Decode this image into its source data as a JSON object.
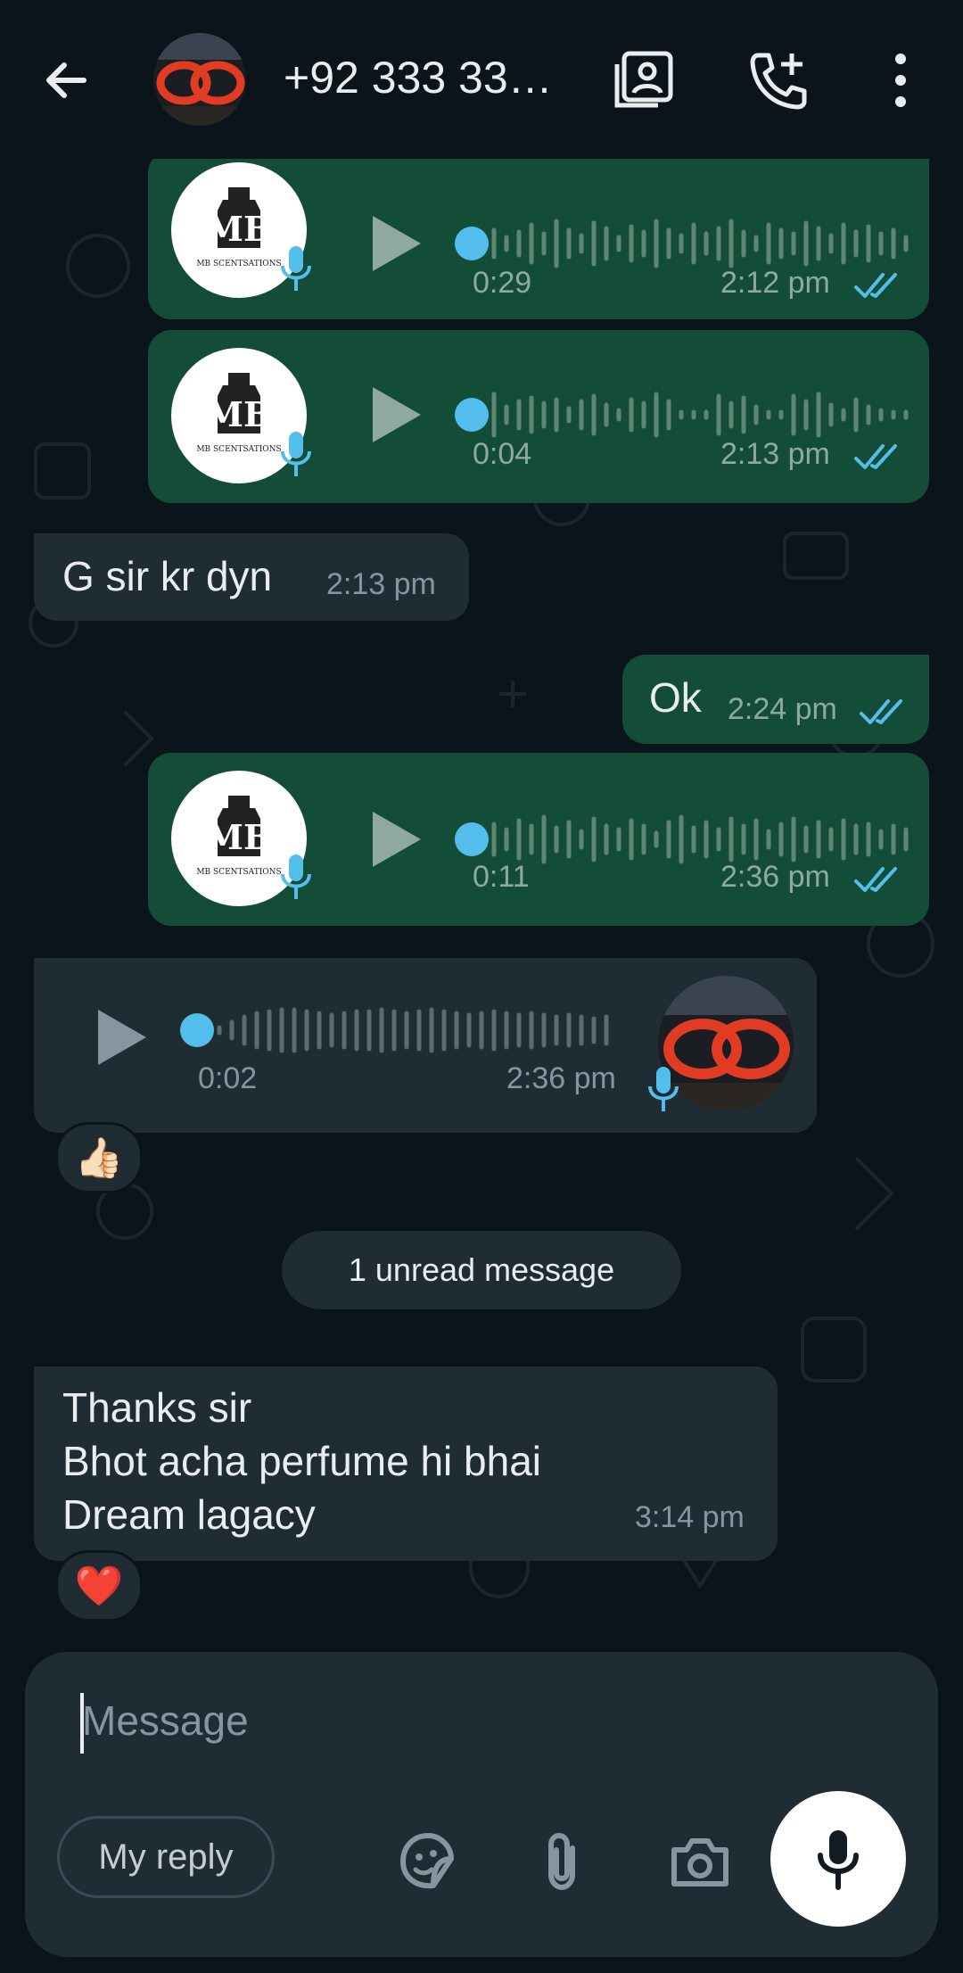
{
  "header": {
    "title": "+92 333 33…",
    "icons": [
      "back-arrow-icon",
      "contact-card-icon",
      "add-call-icon",
      "more-vert-icon"
    ]
  },
  "voice_logo_text": "MB SCENTSATIONS",
  "messages": [
    {
      "type": "voice",
      "direction": "out",
      "duration": "0:29",
      "time": "2:12 pm",
      "status": "read"
    },
    {
      "type": "voice",
      "direction": "out",
      "duration": "0:04",
      "time": "2:13 pm",
      "status": "read"
    },
    {
      "type": "text",
      "direction": "in",
      "text": "G sir kr dyn",
      "time": "2:13 pm"
    },
    {
      "type": "text",
      "direction": "out",
      "text": "Ok",
      "time": "2:24 pm",
      "status": "read"
    },
    {
      "type": "voice",
      "direction": "out",
      "duration": "0:11",
      "time": "2:36 pm",
      "status": "read"
    },
    {
      "type": "voice",
      "direction": "in",
      "duration": "0:02",
      "time": "2:36 pm",
      "reaction": "👍🏻"
    }
  ],
  "unread_label": "1 unread message",
  "last_message": {
    "lines": [
      "Thanks sir",
      "Bhot acha perfume hi bhai",
      "Dream lagacy"
    ],
    "time": "3:14 pm",
    "reaction": "❤️"
  },
  "composer": {
    "placeholder": "Message",
    "my_reply": "My reply",
    "icons": [
      "sticker-icon",
      "attach-icon",
      "camera-icon",
      "mic-icon"
    ]
  },
  "colors": {
    "background": "#0b141a",
    "outgoing_bubble": "#144d37",
    "incoming_bubble": "#1f2c34",
    "read_tick": "#53bdeb",
    "accent_dot": "#53bdeb"
  }
}
